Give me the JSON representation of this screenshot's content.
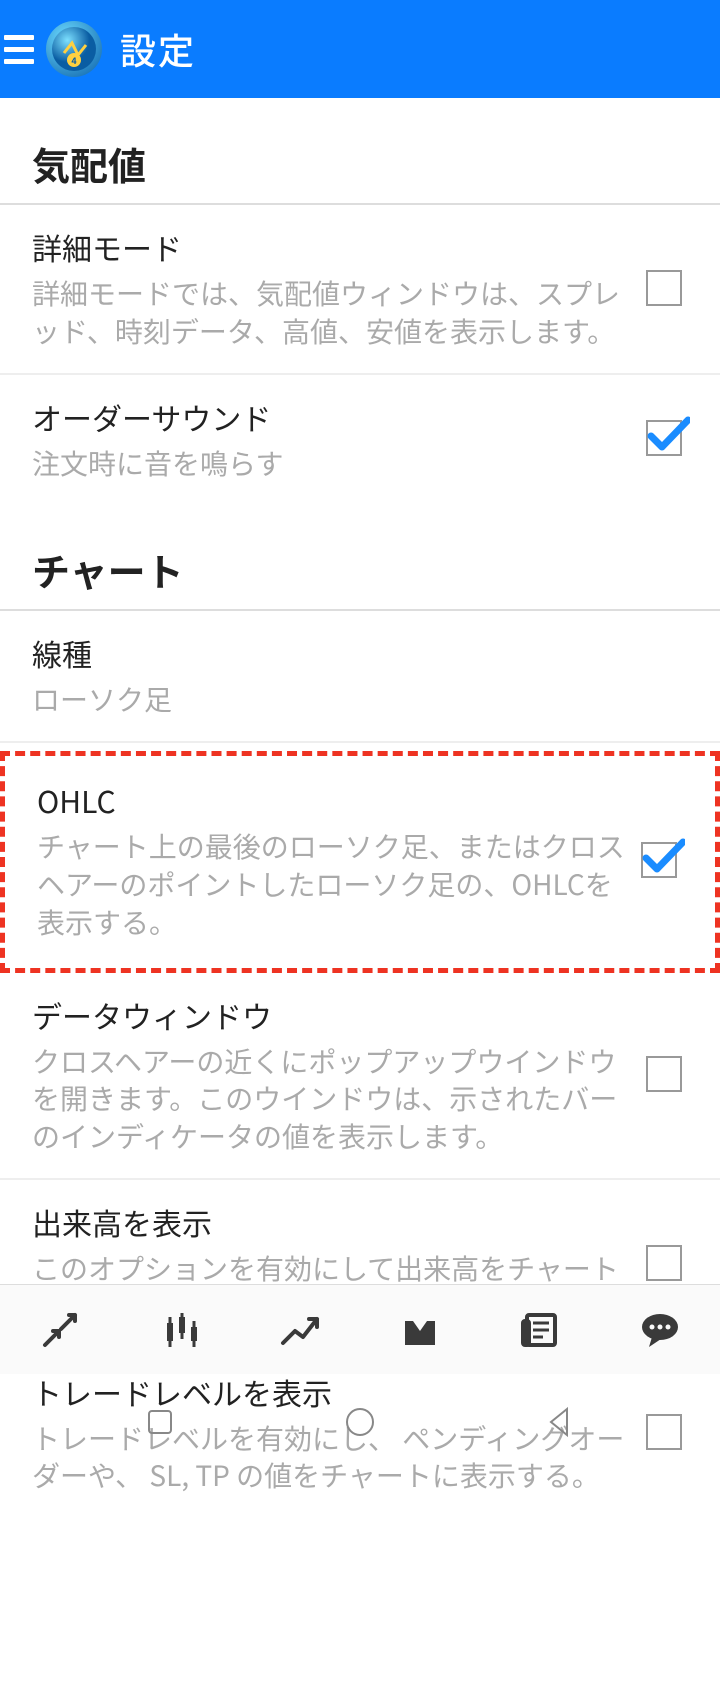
{
  "header": {
    "title": "設定"
  },
  "sections": {
    "quotes": {
      "header": "気配値",
      "detail_mode": {
        "title": "詳細モード",
        "desc": "詳細モードでは、気配値ウィンドウは、スプレッド、時刻データ、高値、安値を表示します。",
        "checked": false
      },
      "order_sound": {
        "title": "オーダーサウンド",
        "desc": "注文時に音を鳴らす",
        "checked": true
      }
    },
    "chart": {
      "header": "チャート",
      "line_type": {
        "title": "線種",
        "value": "ローソク足"
      },
      "ohlc": {
        "title": "OHLC",
        "desc": "チャート上の最後のローソク足、またはクロスヘアーのポイントしたローソク足の、OHLCを表示する。",
        "checked": true
      },
      "data_window": {
        "title": "データウィンドウ",
        "desc": "クロスヘアーの近くにポップアップウインドウを開きます。このウインドウは、示されたバーのインディケータの値を表示します。",
        "checked": false
      },
      "volume": {
        "title": "出来高を表示",
        "desc": "このオプションを有効にして出来高をチャートに表示する",
        "checked": false
      },
      "trade_levels": {
        "title": "トレードレベルを表示",
        "desc": "トレードレベルを有効にし、 ペンディングオーダーや、 SL, TP の値をチャートに表示する。",
        "checked": false
      }
    }
  }
}
